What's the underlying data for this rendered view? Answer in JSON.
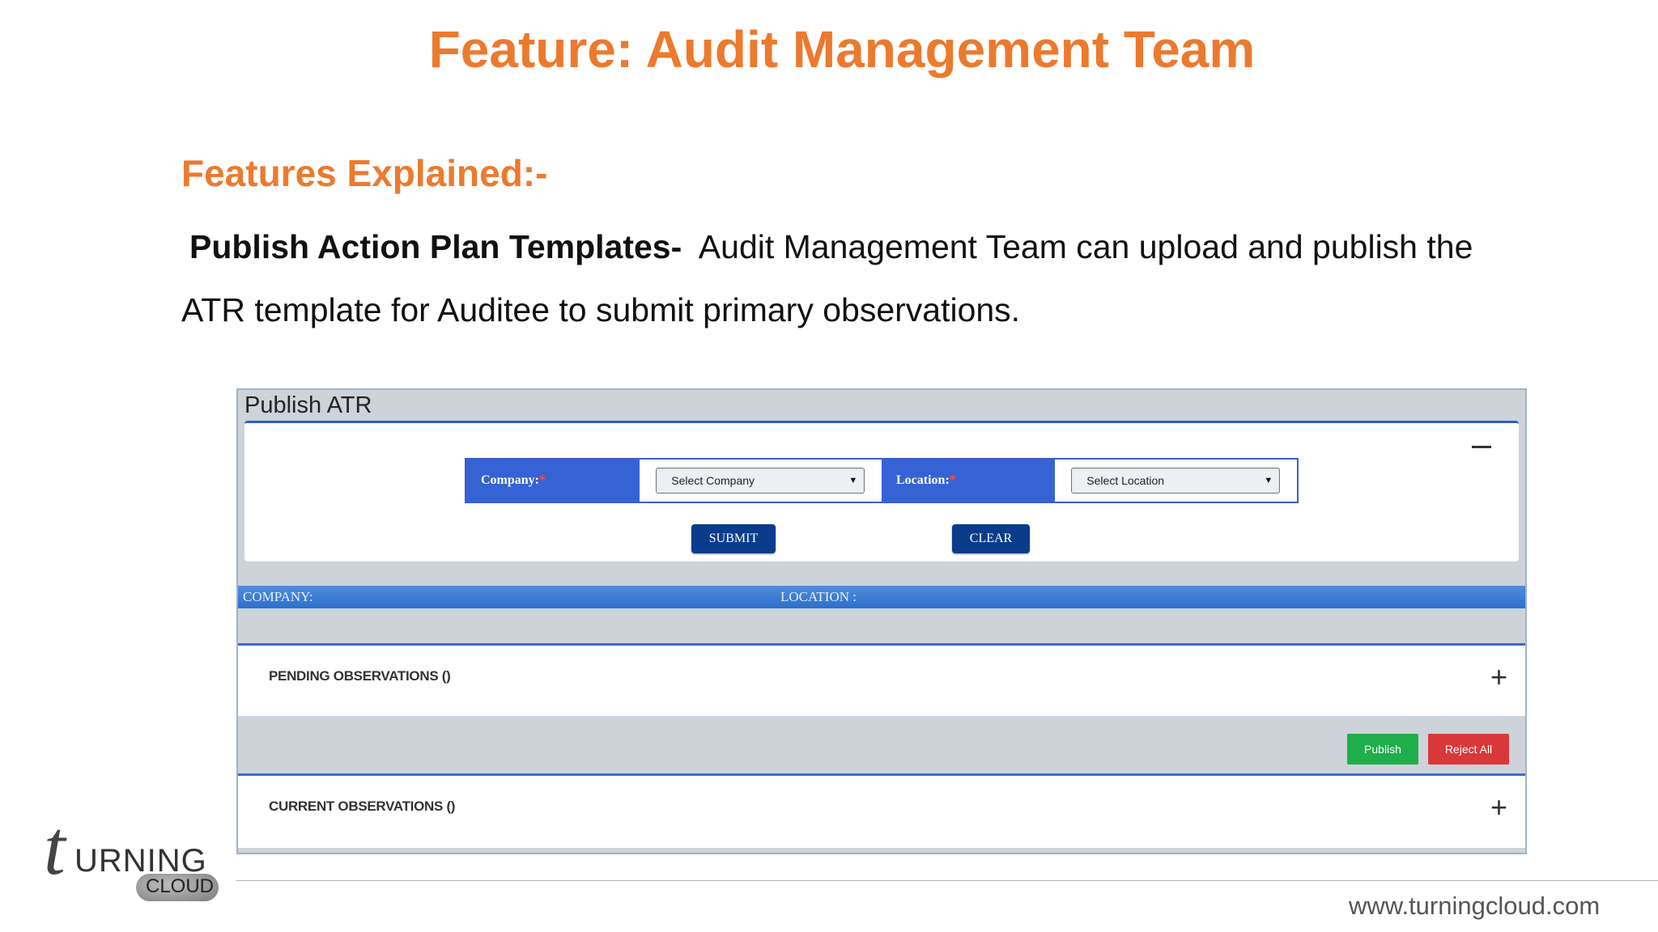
{
  "slide": {
    "title": "Feature: Audit Management Team",
    "section_heading": "Features Explained:-",
    "description_lead": "Publish Action Plan Templates-",
    "description_text": "Audit Management Team can upload and publish the ATR template for Auditee to submit primary observations."
  },
  "app": {
    "title": "Publish ATR",
    "filters": {
      "company_label": "Company:",
      "location_label": "Location:",
      "required_marker": "*",
      "company_value": "Select Company",
      "location_value": "Select Location",
      "caret": "▼"
    },
    "buttons": {
      "submit": "SUBMIT",
      "clear": "CLEAR",
      "publish": "Publish",
      "reject_all": "Reject All"
    },
    "info_bar": {
      "company": "COMPANY:",
      "location": "LOCATION :"
    },
    "panels": {
      "pending": "PENDING OBSERVATIONS ()",
      "current": "CURRENT OBSERVATIONS ()",
      "expand_symbol": "+"
    }
  },
  "footer": {
    "url": "www.turningcloud.com",
    "logo_initial": "t",
    "logo_word": "URNING",
    "logo_cloud": "CLOUD"
  }
}
